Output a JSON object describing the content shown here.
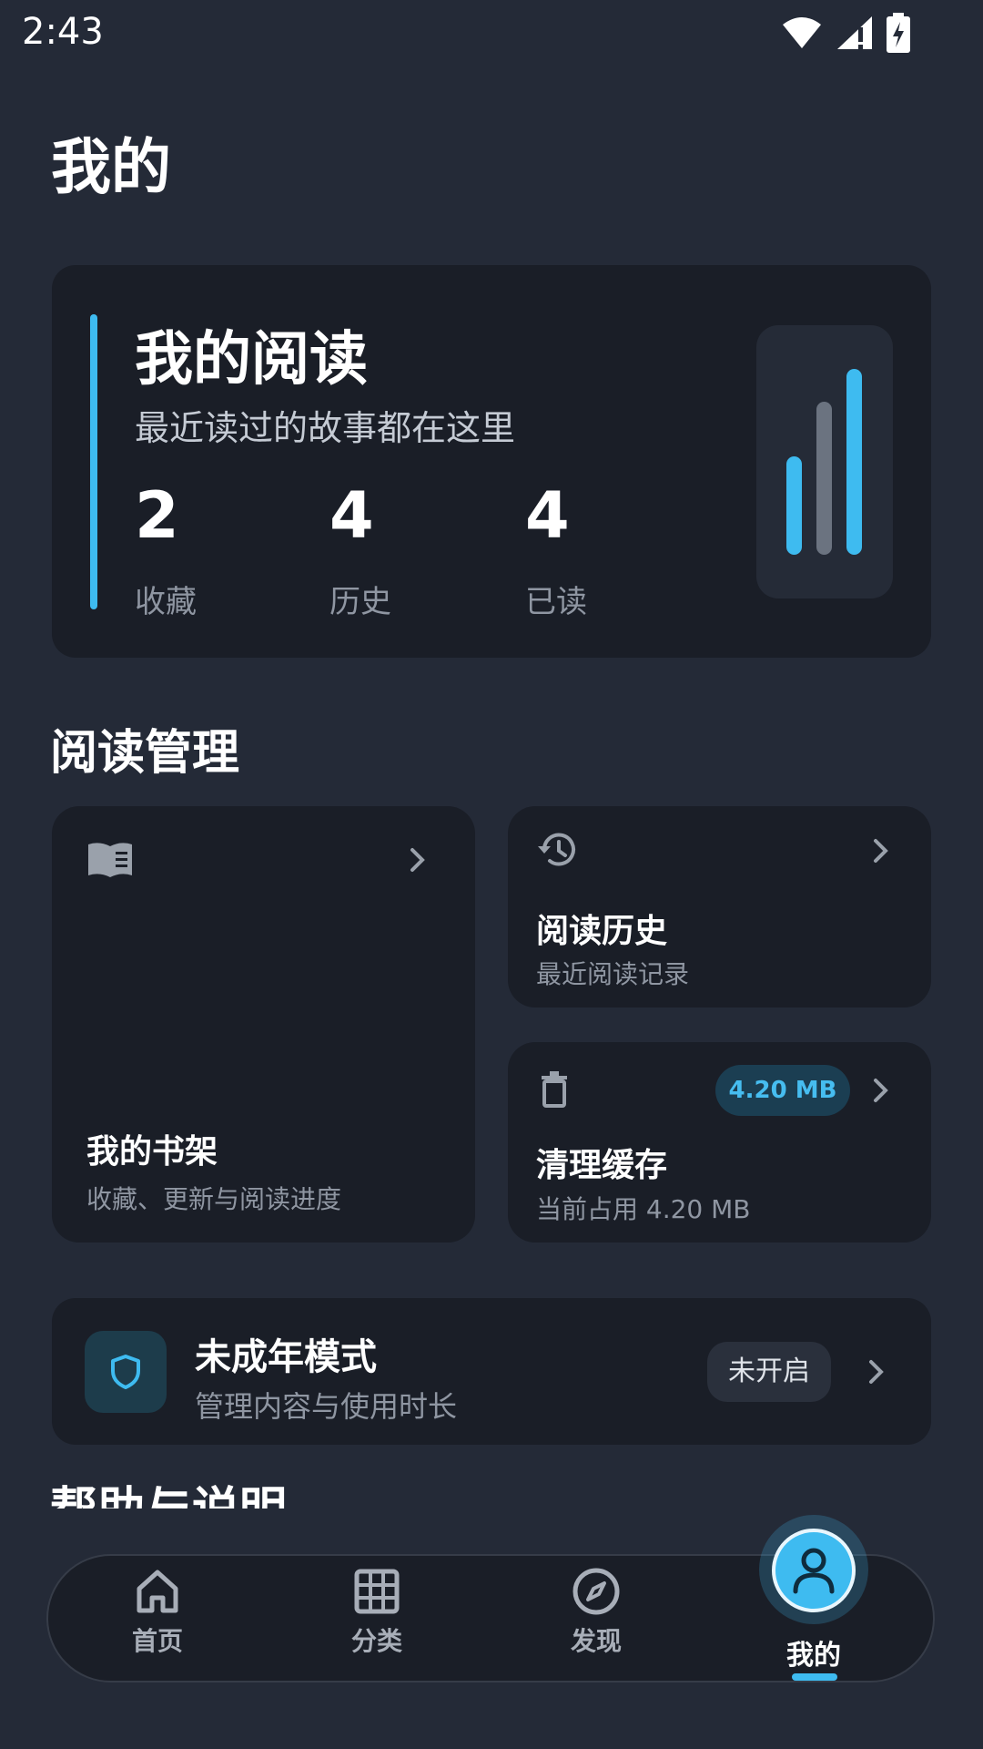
{
  "status_bar": {
    "time": "2:43",
    "icons": [
      "wifi-icon",
      "signal-icon",
      "battery-charging-icon"
    ]
  },
  "page": {
    "title": "我的"
  },
  "reading_card": {
    "title": "我的阅读",
    "subtitle": "最近读过的故事都在这里",
    "stats": [
      {
        "value": "2",
        "label": "收藏"
      },
      {
        "value": "4",
        "label": "历史"
      },
      {
        "value": "4",
        "label": "已读"
      }
    ],
    "accent_color": "#3ebbf0"
  },
  "management": {
    "section_title": "阅读管理",
    "bookshelf": {
      "title": "我的书架",
      "subtitle": "收藏、更新与阅读进度",
      "icon": "book-icon"
    },
    "history": {
      "title": "阅读历史",
      "subtitle": "最近阅读记录",
      "icon": "history-icon"
    },
    "cache": {
      "title": "清理缓存",
      "subtitle": "当前占用 4.20 MB",
      "badge": "4.20 MB",
      "icon": "trash-icon"
    }
  },
  "minor_mode": {
    "title": "未成年模式",
    "subtitle": "管理内容与使用时长",
    "status": "未开启",
    "icon": "shield-icon"
  },
  "help_section": {
    "title": "帮助与说明"
  },
  "bottom_nav": {
    "items": [
      {
        "label": "首页",
        "icon": "home-icon"
      },
      {
        "label": "分类",
        "icon": "grid-icon"
      },
      {
        "label": "发现",
        "icon": "compass-icon"
      },
      {
        "label": "我的",
        "icon": "user-icon",
        "active": true
      }
    ],
    "active_color": "#3ebbf0"
  }
}
